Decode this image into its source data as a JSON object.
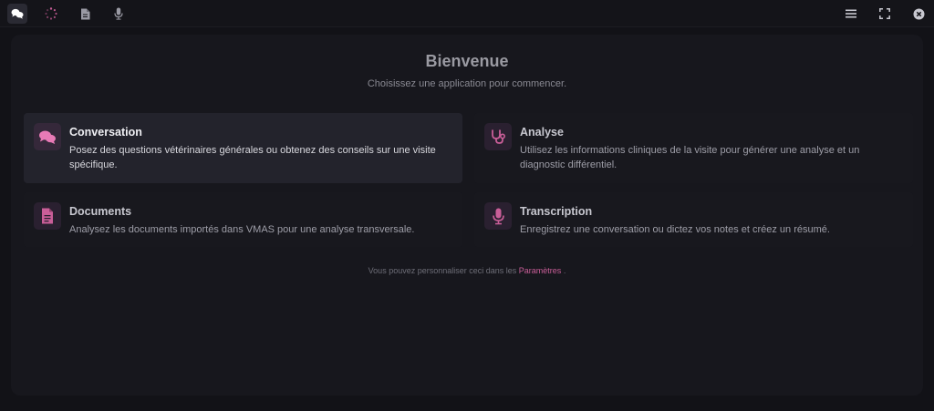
{
  "toolbar": {
    "left_icons": [
      "chat-icon",
      "spinner-icon",
      "document-icon",
      "microphone-icon"
    ],
    "right_icons": [
      "menu-icon",
      "fullscreen-icon",
      "close-icon"
    ],
    "active_tab": "chat"
  },
  "main": {
    "title": "Bienvenue",
    "subtitle": "Choisissez une application pour commencer."
  },
  "apps": [
    {
      "key": "conversation",
      "title": "Conversation",
      "description": "Posez des questions vétérinaires générales ou obtenez des conseils sur une visite spécifique.",
      "icon": "chat-bubbles-icon",
      "selected": true
    },
    {
      "key": "analyse",
      "title": "Analyse",
      "description": "Utilisez les informations cliniques de la visite pour générer une analyse et un diagnostic différentiel.",
      "icon": "stethoscope-icon",
      "selected": false
    },
    {
      "key": "documents",
      "title": "Documents",
      "description": "Analysez les documents importés dans VMAS pour une analyse transversale.",
      "icon": "document-icon",
      "selected": false
    },
    {
      "key": "transcription",
      "title": "Transcription",
      "description": "Enregistrez une conversation ou dictez vos notes et créez un résumé.",
      "icon": "microphone-icon",
      "selected": false
    }
  ],
  "footer": {
    "text_before": "Vous pouvez personnaliser ceci dans les ",
    "link": "Paramètres",
    "text_after": " ."
  },
  "colors": {
    "accent": "#c95e98",
    "background": "#121217",
    "panel": "#17171d",
    "card_selected": "#23232c"
  }
}
